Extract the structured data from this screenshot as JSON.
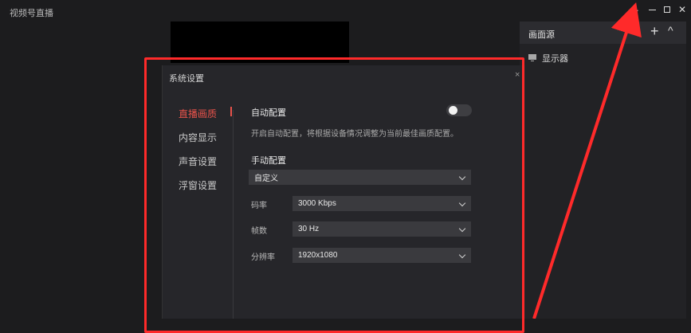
{
  "app": {
    "title": "视频号直播",
    "more_label": "···"
  },
  "source_panel": {
    "title": "画面源",
    "add_label": "+",
    "collapse_label": "^",
    "items": [
      {
        "label": "显示器"
      }
    ]
  },
  "dialog": {
    "title": "系统设置",
    "close_label": "×",
    "nav": [
      {
        "label": "直播画质",
        "active": true
      },
      {
        "label": "内容显示",
        "active": false
      },
      {
        "label": "声音设置",
        "active": false
      },
      {
        "label": "浮窗设置",
        "active": false
      }
    ],
    "auto_config": {
      "label": "自动配置",
      "description": "开启自动配置，将根据设备情况调整为当前最佳画质配置。",
      "enabled": false
    },
    "manual_config": {
      "label": "手动配置",
      "preset_value": "自定义",
      "bitrate": {
        "label": "码率",
        "value": "3000 Kbps"
      },
      "framerate": {
        "label": "帧数",
        "value": "30 Hz"
      },
      "resolution": {
        "label": "分辨率",
        "value": "1920x1080"
      }
    }
  },
  "annotation": {
    "color": "#ff2a2a"
  }
}
